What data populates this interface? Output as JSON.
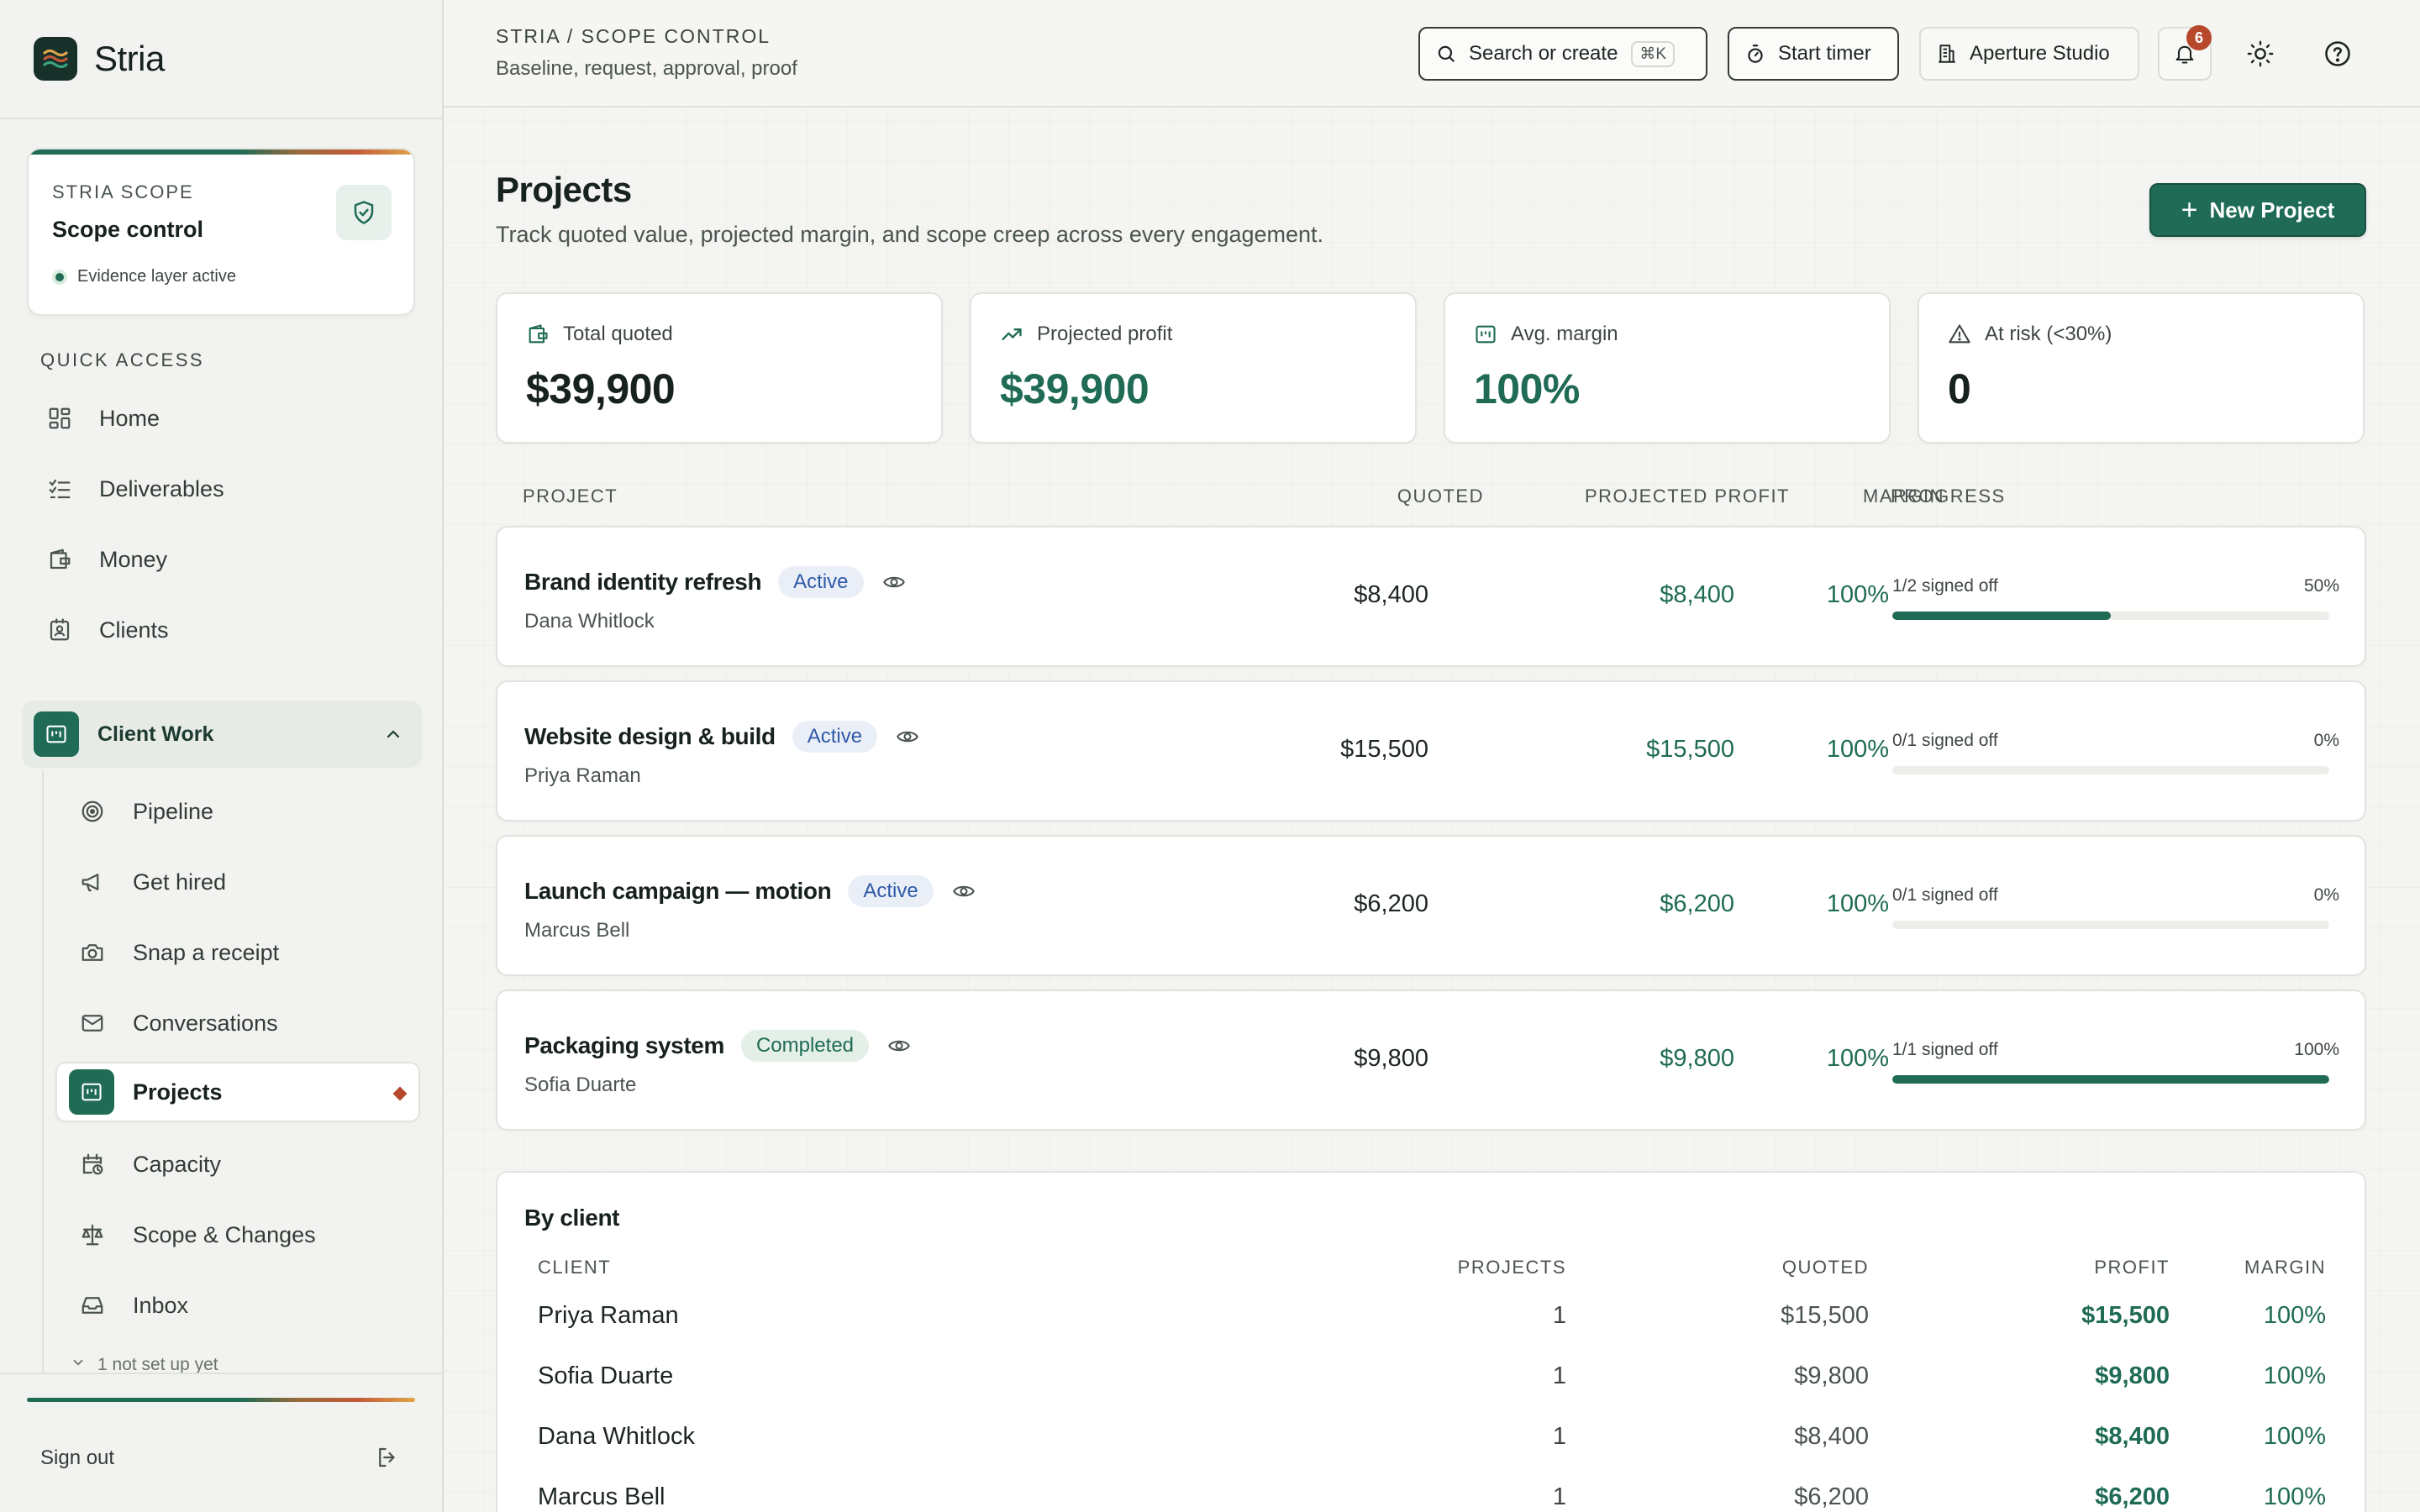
{
  "brand": {
    "name": "Stria"
  },
  "scope_card": {
    "eyebrow": "STRIA SCOPE",
    "title": "Scope control",
    "status": "Evidence layer active"
  },
  "sidebar": {
    "section_label": "QUICK ACCESS",
    "quick_items": [
      {
        "label": "Home",
        "icon": "grid-icon"
      },
      {
        "label": "Deliverables",
        "icon": "checklist-icon"
      },
      {
        "label": "Money",
        "icon": "wallet-icon"
      },
      {
        "label": "Clients",
        "icon": "contact-card-icon"
      }
    ],
    "group": {
      "label": "Client Work",
      "items": [
        {
          "label": "Pipeline",
          "icon": "target-icon"
        },
        {
          "label": "Get hired",
          "icon": "megaphone-icon"
        },
        {
          "label": "Snap a receipt",
          "icon": "camera-icon"
        },
        {
          "label": "Conversations",
          "icon": "mail-icon"
        },
        {
          "label": "Projects",
          "icon": "projects-icon",
          "active": true
        },
        {
          "label": "Capacity",
          "icon": "calendar-clock-icon"
        },
        {
          "label": "Scope & Changes",
          "icon": "scale-icon"
        },
        {
          "label": "Inbox",
          "icon": "inbox-icon"
        }
      ],
      "more_hint": "1 not set up yet"
    },
    "sign_out": "Sign out"
  },
  "topbar": {
    "breadcrumb": "STRIA / SCOPE CONTROL",
    "subtitle": "Baseline, request, approval, proof",
    "search_label": "Search or create",
    "search_shortcut": "⌘K",
    "timer_label": "Start timer",
    "workspace_label": "Aperture Studio",
    "notification_count": "6"
  },
  "page": {
    "title": "Projects",
    "subtitle": "Track quoted value, projected margin, and scope creep across every engagement.",
    "new_button": "New Project"
  },
  "kpis": [
    {
      "label": "Total quoted",
      "value": "$39,900",
      "icon": "wallet-icon"
    },
    {
      "label": "Projected profit",
      "value": "$39,900",
      "icon": "trending-up-icon"
    },
    {
      "label": "Avg. margin",
      "value": "100%",
      "icon": "projects-icon"
    },
    {
      "label": "At risk (<30%)",
      "value": "0",
      "icon": "warning-icon"
    }
  ],
  "projects_table": {
    "headers": {
      "project": "PROJECT",
      "quoted": "QUOTED",
      "profit": "PROJECTED PROFIT",
      "margin": "MARGIN",
      "progress": "PROGRESS"
    },
    "rows": [
      {
        "name": "Brand identity refresh",
        "status": "Active",
        "client": "Dana Whitlock",
        "quoted": "$8,400",
        "profit": "$8,400",
        "margin": "100%",
        "progress_label": "1/2 signed off",
        "progress_pct": "50%",
        "progress": 0.5
      },
      {
        "name": "Website design & build",
        "status": "Active",
        "client": "Priya Raman",
        "quoted": "$15,500",
        "profit": "$15,500",
        "margin": "100%",
        "progress_label": "0/1 signed off",
        "progress_pct": "0%",
        "progress": 0
      },
      {
        "name": "Launch campaign — motion",
        "status": "Active",
        "client": "Marcus Bell",
        "quoted": "$6,200",
        "profit": "$6,200",
        "margin": "100%",
        "progress_label": "0/1 signed off",
        "progress_pct": "0%",
        "progress": 0
      },
      {
        "name": "Packaging system",
        "status": "Completed",
        "client": "Sofia Duarte",
        "quoted": "$9,800",
        "profit": "$9,800",
        "margin": "100%",
        "progress_label": "1/1 signed off",
        "progress_pct": "100%",
        "progress": 1
      }
    ]
  },
  "by_client": {
    "title": "By client",
    "headers": {
      "client": "CLIENT",
      "projects": "PROJECTS",
      "quoted": "QUOTED",
      "profit": "PROFIT",
      "margin": "MARGIN"
    },
    "rows": [
      {
        "client": "Priya Raman",
        "projects": "1",
        "quoted": "$15,500",
        "profit": "$15,500",
        "margin": "100%"
      },
      {
        "client": "Sofia Duarte",
        "projects": "1",
        "quoted": "$9,800",
        "profit": "$9,800",
        "margin": "100%"
      },
      {
        "client": "Dana Whitlock",
        "projects": "1",
        "quoted": "$8,400",
        "profit": "$8,400",
        "margin": "100%"
      },
      {
        "client": "Marcus Bell",
        "projects": "1",
        "quoted": "$6,200",
        "profit": "$6,200",
        "margin": "100%"
      }
    ]
  },
  "colors": {
    "accent": "#1f6b55",
    "alert": "#b8482c",
    "active_pill": "#2f5aa8"
  }
}
